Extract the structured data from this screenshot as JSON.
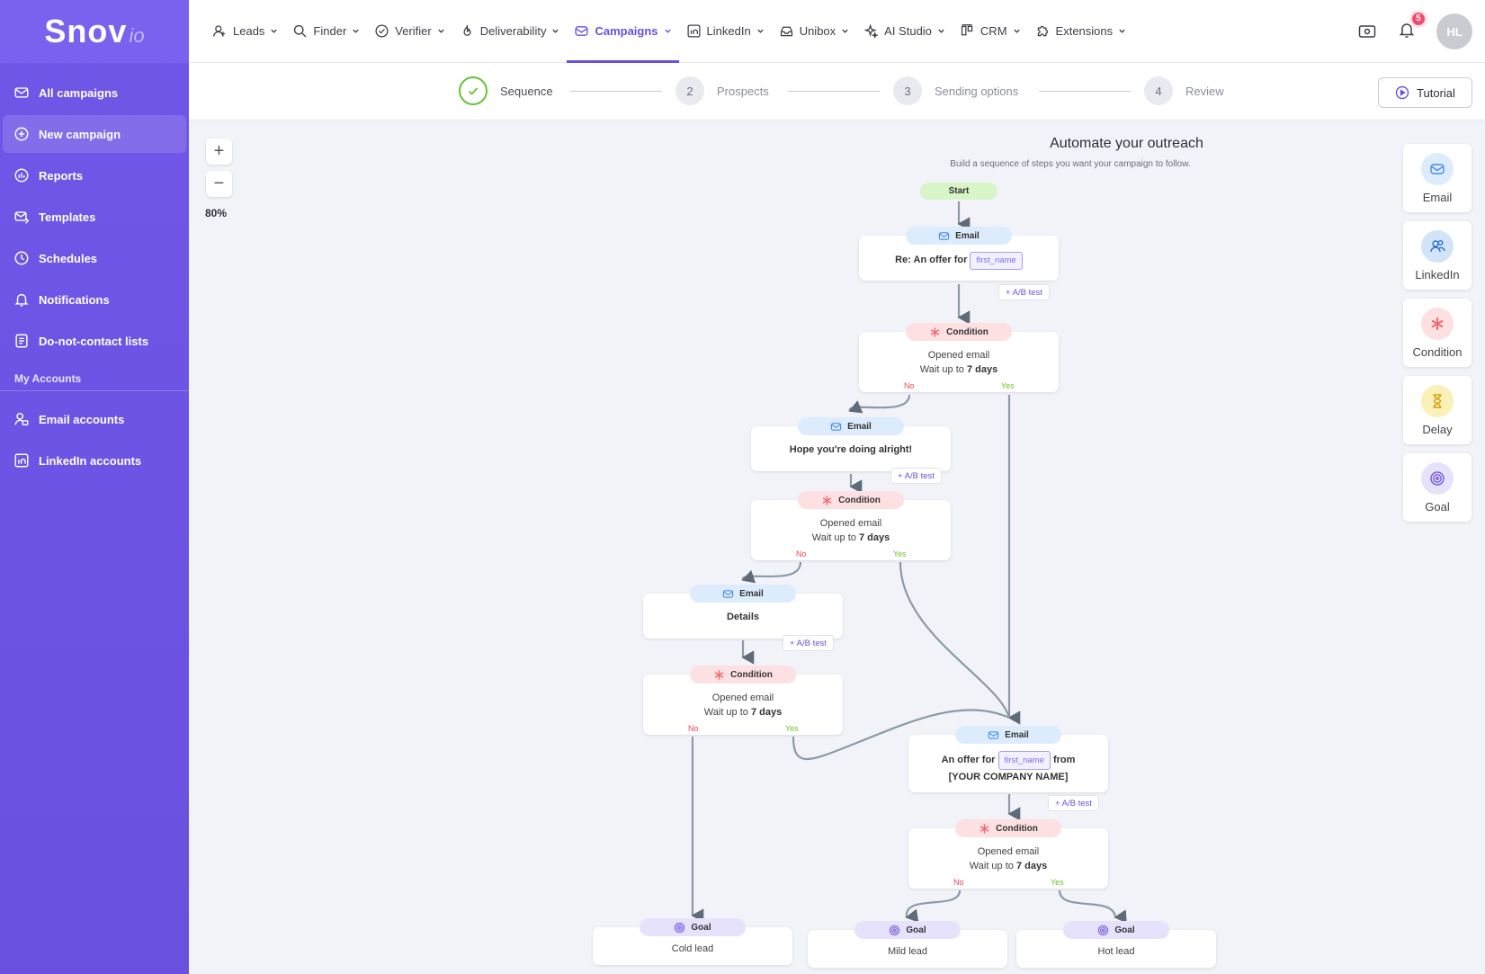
{
  "logo": {
    "main": "Snov",
    "sub": "io"
  },
  "sidebar": {
    "items": [
      {
        "label": "All campaigns"
      },
      {
        "label": "New campaign"
      },
      {
        "label": "Reports"
      },
      {
        "label": "Templates"
      },
      {
        "label": "Schedules"
      },
      {
        "label": "Notifications"
      },
      {
        "label": "Do-not-contact lists"
      }
    ],
    "section_label": "My Accounts",
    "account_items": [
      {
        "label": "Email accounts"
      },
      {
        "label": "LinkedIn accounts"
      }
    ]
  },
  "topnav": {
    "items": [
      {
        "label": "Leads"
      },
      {
        "label": "Finder"
      },
      {
        "label": "Verifier"
      },
      {
        "label": "Deliverability"
      },
      {
        "label": "Campaigns"
      },
      {
        "label": "LinkedIn"
      },
      {
        "label": "Unibox"
      },
      {
        "label": "AI Studio"
      },
      {
        "label": "CRM"
      },
      {
        "label": "Extensions"
      }
    ],
    "notification_count": "5",
    "avatar_initials": "HL"
  },
  "stepper": {
    "steps": [
      {
        "num": "1",
        "label": "Sequence"
      },
      {
        "num": "2",
        "label": "Prospects"
      },
      {
        "num": "3",
        "label": "Sending options"
      },
      {
        "num": "4",
        "label": "Review"
      }
    ],
    "tutorial_label": "Tutorial"
  },
  "canvas": {
    "title": "Automate your outreach",
    "subtitle": "Build a sequence of steps you want your campaign to follow.",
    "zoom_in": "+",
    "zoom_out": "−",
    "zoom_level": "80%",
    "start_label": "Start",
    "email_label": "Email",
    "condition_label": "Condition",
    "goal_label": "Goal",
    "ab_test_label": "+ A/B test",
    "no_label": "No",
    "yes_label": "Yes",
    "email1": {
      "subject_prefix": "Re: An offer for",
      "tag": "first_name"
    },
    "cond_text": "Opened email",
    "wait_prefix": "Wait up to",
    "wait_value": "7 days",
    "email2": {
      "subject": "Hope you're doing alright!"
    },
    "email3": {
      "subject": "Details"
    },
    "email4": {
      "subject_prefix": "An offer for",
      "tag": "first_name",
      "subject_suffix": "from",
      "company": "[YOUR COMPANY NAME]"
    },
    "goals": {
      "cold": "Cold lead",
      "mild": "Mild lead",
      "hot": "Hot lead"
    }
  },
  "palette": {
    "items": [
      {
        "label": "Email",
        "color": "#dcecfd"
      },
      {
        "label": "LinkedIn",
        "color": "#d2e4f8"
      },
      {
        "label": "Condition",
        "color": "#fde0e2"
      },
      {
        "label": "Delay",
        "color": "#fbf0b8"
      },
      {
        "label": "Goal",
        "color": "#e7e2fb"
      }
    ]
  },
  "colors": {
    "accent": "#6b50e0",
    "sidebar": "#6b50e0",
    "success": "#67c23a",
    "no": "#e5484d",
    "yes": "#72c030"
  }
}
